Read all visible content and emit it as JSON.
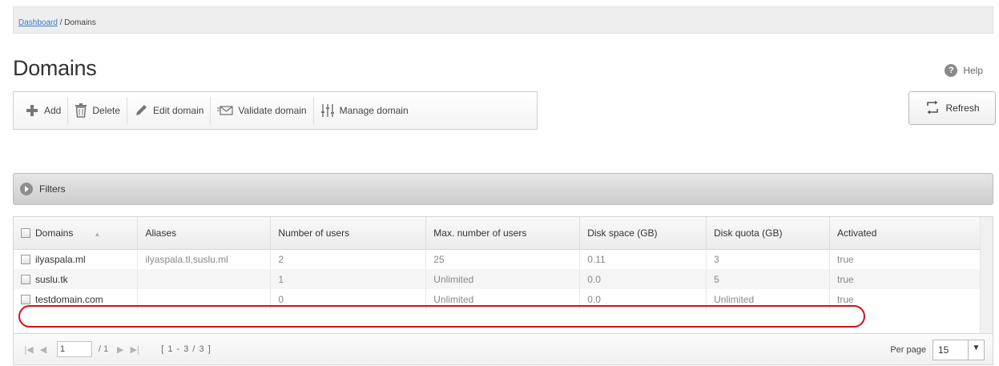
{
  "breadcrumb": {
    "link": "Dashboard",
    "separator": " / ",
    "current": "Domains"
  },
  "page": {
    "title": "Domains",
    "help_label": "Help",
    "help_icon": "question-circle-icon"
  },
  "toolbar": {
    "add": "Add",
    "delete": "Delete",
    "edit": "Edit domain",
    "validate": "Validate domain",
    "manage": "Manage domain",
    "refresh": "Refresh"
  },
  "filters": {
    "label": "Filters"
  },
  "table": {
    "headers": [
      "Domains",
      "Aliases",
      "Number of users",
      "Max. number of users",
      "Disk space (GB)",
      "Disk quota (GB)",
      "Activated"
    ],
    "rows": [
      [
        "ilyaspala.ml",
        "ilyaspala.tl,suslu.ml",
        "2",
        "25",
        "0.11",
        "3",
        "true"
      ],
      [
        "suslu.tk",
        "",
        "1",
        "Unlimited",
        "0.0",
        "5",
        "true"
      ],
      [
        "testdomain.com",
        "",
        "0",
        "Unlimited",
        "0.0",
        "Unlimited",
        "true"
      ]
    ],
    "highlighted_row": 2,
    "highlight_color": "#d0111a"
  },
  "pager": {
    "page": "1",
    "of": "/ 1",
    "range": "[ 1 - 3 / 3 ]",
    "per_page_label": "Per page",
    "per_page_value": "15"
  },
  "colors": {
    "link": "#3b7bbf",
    "highlight": "#d0111a"
  }
}
